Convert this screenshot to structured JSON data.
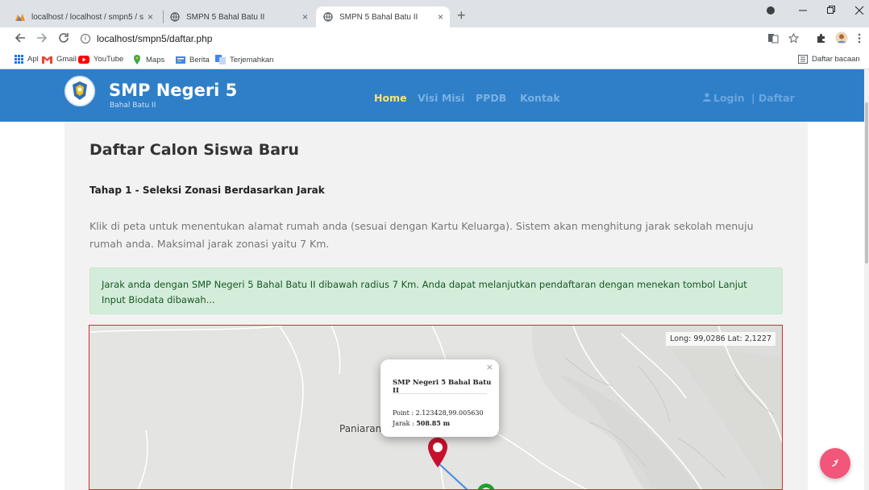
{
  "browser": {
    "tabs": [
      {
        "title": "localhost / localhost / smpn5 / s",
        "close": "×"
      },
      {
        "title": "SMPN 5 Bahal Batu II",
        "close": "×"
      },
      {
        "title": "SMPN 5 Bahal Batu II",
        "close": "×",
        "active": true
      }
    ],
    "new_tab": "+",
    "url": "localhost/smpn5/daftar.php",
    "bookmarks": [
      "Apl",
      "Gmail",
      "YouTube",
      "Maps",
      "Berita",
      "Terjemahkan"
    ],
    "reading_list": "Daftar bacaan"
  },
  "site": {
    "brand": "SMP Negeri 5",
    "brand_sub": "Bahal Batu II",
    "menu": [
      "Home",
      "Visi Misi",
      "PPDB",
      "Kontak"
    ],
    "login": "Login",
    "daftar": "| Daftar"
  },
  "main": {
    "title": "Daftar Calon Siswa Baru",
    "step": "Tahap 1 - Seleksi Zonasi Berdasarkan Jarak",
    "description": "Klik di peta untuk menentukan alamat rumah anda (sesuai dengan Kartu Keluarga). Sistem akan menghitung jarak sekolah menuju rumah anda. Maksimal jarak zonasi yaitu 7 Km.",
    "alert": "Jarak anda dengan SMP Negeri 5 Bahal Batu II dibawah radius 7 Km. Anda dapat melanjutkan pendaftaran dengan menekan tombol Lanjut Input Biodata dibawah..."
  },
  "map": {
    "coords": "Long: 99,0286 Lat: 2,1227",
    "place": "Paniaran",
    "popup": {
      "title": "SMP Negeri 5 Bahal Batu II",
      "point": "Point : 2.123428,99.005630",
      "distance_label": "Jarak : ",
      "distance_value": "508.85 m"
    }
  },
  "colors": {
    "navbar": "#2f7fc8",
    "active_menu": "#ffe26b",
    "alert_bg": "#d4edda",
    "marker_red": "#c8102e",
    "marker_green": "#1fa02a",
    "fab": "#f2567a"
  }
}
